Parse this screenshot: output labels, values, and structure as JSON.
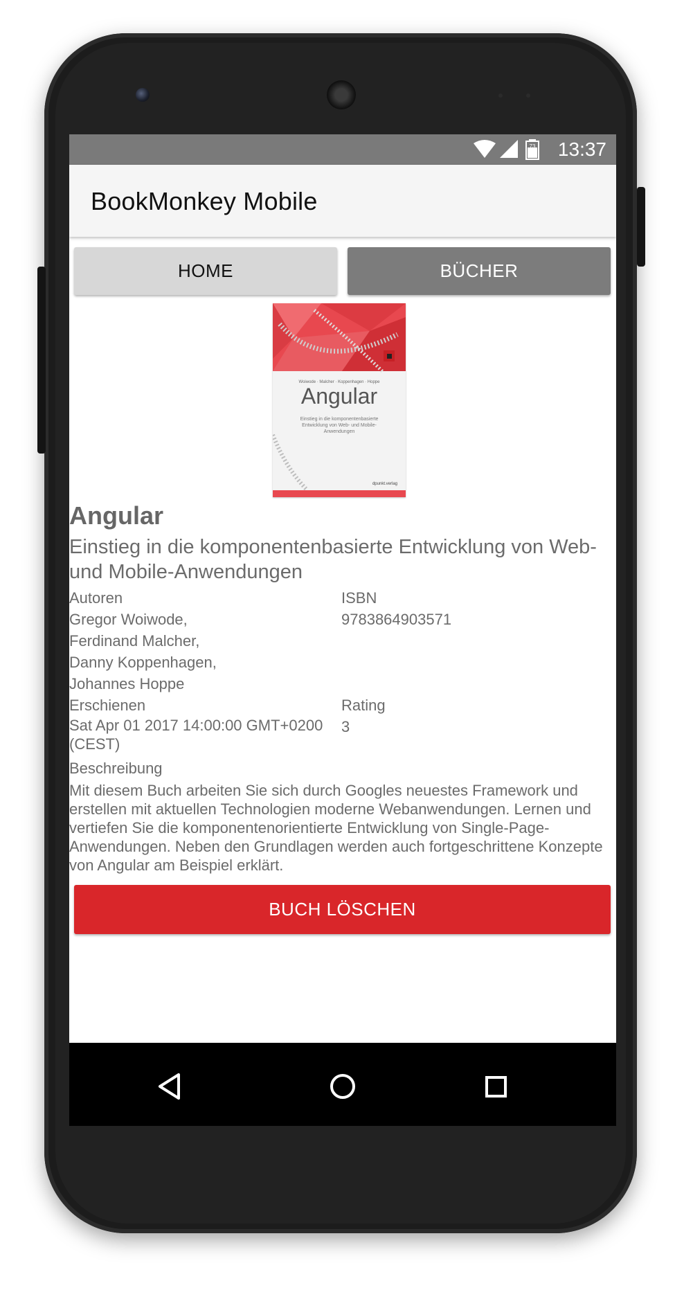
{
  "status_bar": {
    "time": "13:37",
    "battery_level": "73",
    "icons": [
      "wifi-icon",
      "signal-icon",
      "battery-icon"
    ]
  },
  "app_bar": {
    "title": "BookMonkey Mobile"
  },
  "tabs": [
    {
      "label": "HOME",
      "active": false
    },
    {
      "label": "BÜCHER",
      "active": true
    }
  ],
  "book": {
    "cover": {
      "authors_line": "Woiwode · Malcher · Koppenhagen · Hoppe",
      "title": "Angular",
      "subtitle": "Einstieg in die komponentenbasierte Entwicklung von Web- und Mobile-Anwendungen",
      "publisher": "dpunkt.verlag"
    },
    "title": "Angular",
    "subtitle": "Einstieg in die komponentenbasierte Entwicklung von Web- und Mobile-Anwendungen",
    "authors_label": "Autoren",
    "authors": [
      "Gregor Woiwode,",
      "Ferdinand Malcher,",
      "Danny Koppenhagen,",
      "Johannes Hoppe"
    ],
    "isbn_label": "ISBN",
    "isbn": "9783864903571",
    "published_label": "Erschienen",
    "published": "Sat Apr 01 2017 14:00:00 GMT+0200 (CEST)",
    "rating_label": "Rating",
    "rating": "3",
    "description_label": "Beschreibung",
    "description": "Mit diesem Buch arbeiten Sie sich durch Googles neuestes Framework und erstellen mit aktuellen Technologien moderne Webanwendungen. Lernen und vertiefen Sie die komponentenorientierte Entwicklung von Single-Page-Anwendungen. Neben den Grundlagen werden auch fortgeschrittene Konzepte von Angular am Beispiel erklärt."
  },
  "actions": {
    "delete_label": "BUCH LÖSCHEN"
  },
  "nav_bar": {
    "icons": [
      "back-icon",
      "home-icon",
      "recents-icon"
    ]
  },
  "colors": {
    "accent_red": "#d9262a",
    "active_tab": "#7c7c7c",
    "inactive_tab": "#d7d7d7",
    "status_bar": "#7a7a7a"
  }
}
